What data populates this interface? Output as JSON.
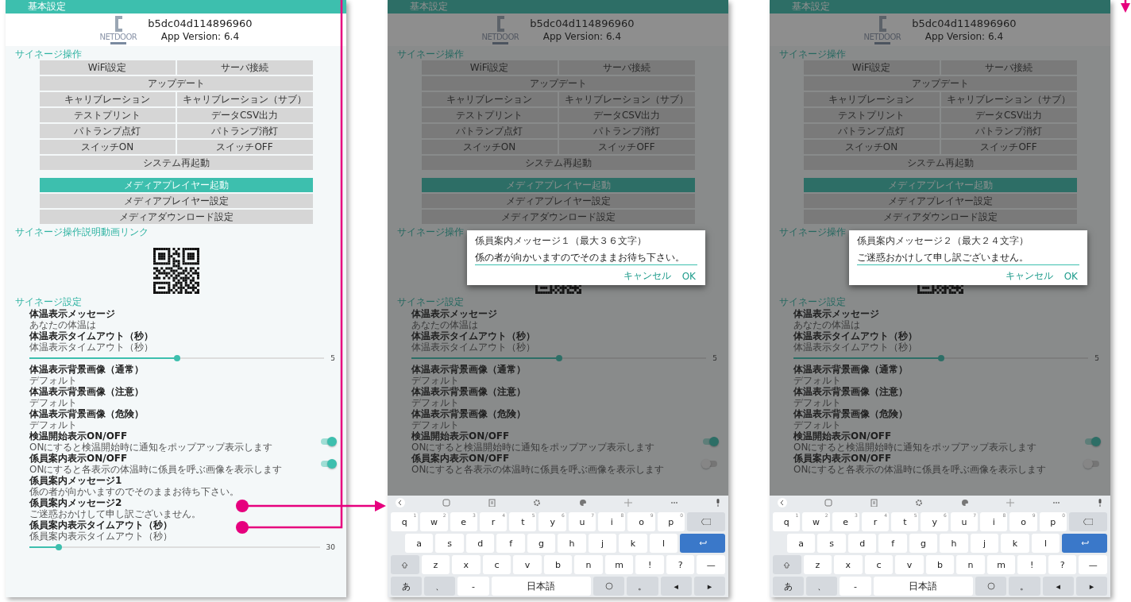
{
  "screens": [
    {
      "app_bar": {
        "title": "基本設定"
      },
      "device": {
        "id": "b5dc04d114896960",
        "version": "App Version: 6.4"
      },
      "logo_text": "NETDOOR",
      "sections": [
        {
          "kind": "buttons",
          "title": "サイネージ操作",
          "groups": [
            [
              [
                {
                  "label": "WiFi設定",
                  "highlighted": false
                },
                {
                  "label": "サーバ接続",
                  "highlighted": false
                }
              ]
            ],
            [
              [
                {
                  "label": "アップデート",
                  "highlighted": false
                }
              ]
            ],
            [
              [
                {
                  "label": "キャリブレーション",
                  "highlighted": false
                },
                {
                  "label": "キャリブレーション（サブ）",
                  "highlighted": false
                }
              ]
            ],
            [
              [
                {
                  "label": "テストプリント",
                  "highlighted": false
                },
                {
                  "label": "データCSV出力",
                  "highlighted": false
                }
              ]
            ],
            [
              [
                {
                  "label": "パトランプ点灯",
                  "highlighted": false
                },
                {
                  "label": "パトランプ消灯",
                  "highlighted": false
                }
              ]
            ],
            [
              [
                {
                  "label": "スイッチON",
                  "highlighted": false
                },
                {
                  "label": "スイッチOFF",
                  "highlighted": false
                }
              ]
            ],
            [
              [
                {
                  "label": "システム再起動",
                  "highlighted": false
                }
              ],
              [
                {
                  "label": "メディアプレイヤー起動",
                  "highlighted": true
                }
              ],
              [
                {
                  "label": "メディアプレイヤー設定",
                  "highlighted": false
                }
              ],
              [
                {
                  "label": "メディアダウンロード設定",
                  "highlighted": false
                }
              ]
            ]
          ]
        },
        {
          "kind": "qr",
          "title": "サイネージ操作説明動画リンク"
        },
        {
          "kind": "settings",
          "title": "サイネージ設定",
          "items": [
            {
              "kind": "text",
              "title": "体温表示メッセージ",
              "summary": "あなたの体温は"
            },
            {
              "kind": "slider",
              "title": "体温表示タイムアウト（秒）",
              "summary": "体温表示タイムアウト（秒）",
              "level": 0.5,
              "reading": "5"
            },
            {
              "kind": "text",
              "title": "体温表示背景画像（通常）",
              "summary": "デフォルト"
            },
            {
              "kind": "text",
              "title": "体温表示背景画像（注意）",
              "summary": "デフォルト"
            },
            {
              "kind": "text",
              "title": "体温表示背景画像（危険）",
              "summary": "デフォルト"
            },
            {
              "kind": "toggle",
              "title": "検温開始表示ON/OFF",
              "summary": "ONにすると検温開始時に通知をポップアップ表示します",
              "on": true
            },
            {
              "kind": "toggle",
              "title": "係員案内表示ON/OFF",
              "summary": "ONにすると各表示の体温時に係員を呼ぶ画像を表示します",
              "on": true
            },
            {
              "kind": "text",
              "title": "係員案内メッセージ1",
              "summary": "係の者が向かいますのでそのままお待ち下さい。"
            },
            {
              "kind": "text",
              "title": "係員案内メッセージ2",
              "summary": "ご迷惑おかけして申し訳ございません。"
            },
            {
              "kind": "slider",
              "title": "係員案内表示タイムアウト（秒）",
              "summary": "係員案内表示タイムアウト（秒）",
              "level": 0.1,
              "reading": "30"
            }
          ]
        }
      ]
    },
    {
      "app_bar": {
        "title": "基本設定"
      },
      "device": {
        "id": "b5dc04d114896960",
        "version": "App Version: 6.4"
      },
      "logo_text": "NETDOOR",
      "sections": [
        {
          "kind": "buttons",
          "title": "サイネージ操作",
          "groups": [
            [
              [
                {
                  "label": "WiFi設定",
                  "highlighted": false
                },
                {
                  "label": "サーバ接続",
                  "highlighted": false
                }
              ]
            ],
            [
              [
                {
                  "label": "アップデート",
                  "highlighted": false
                }
              ]
            ],
            [
              [
                {
                  "label": "キャリブレーション",
                  "highlighted": false
                },
                {
                  "label": "キャリブレーション（サブ）",
                  "highlighted": false
                }
              ]
            ],
            [
              [
                {
                  "label": "テストプリント",
                  "highlighted": false
                },
                {
                  "label": "データCSV出力",
                  "highlighted": false
                }
              ]
            ],
            [
              [
                {
                  "label": "パトランプ点灯",
                  "highlighted": false
                },
                {
                  "label": "パトランプ消灯",
                  "highlighted": false
                }
              ]
            ],
            [
              [
                {
                  "label": "スイッチON",
                  "highlighted": false
                },
                {
                  "label": "スイッチOFF",
                  "highlighted": false
                }
              ]
            ],
            [
              [
                {
                  "label": "システム再起動",
                  "highlighted": false
                }
              ],
              [
                {
                  "label": "メディアプレイヤー起動",
                  "highlighted": true
                }
              ],
              [
                {
                  "label": "メディアプレイヤー設定",
                  "highlighted": false
                }
              ],
              [
                {
                  "label": "メディアダウンロード設定",
                  "highlighted": false
                }
              ]
            ]
          ]
        },
        {
          "kind": "qr",
          "title": "サイネージ操作"
        },
        {
          "kind": "settings",
          "title": "サイネージ設定",
          "items": [
            {
              "kind": "text",
              "title": "体温表示メッセージ",
              "summary": "あなたの体温は"
            },
            {
              "kind": "slider",
              "title": "体温表示タイムアウト（秒）",
              "summary": "体温表示タイムアウト（秒）",
              "level": 0.5,
              "reading": "5"
            },
            {
              "kind": "text",
              "title": "体温表示背景画像（通常）",
              "summary": "デフォルト"
            },
            {
              "kind": "text",
              "title": "体温表示背景画像（注意）",
              "summary": "デフォルト"
            },
            {
              "kind": "text",
              "title": "体温表示背景画像（危険）",
              "summary": "デフォルト"
            },
            {
              "kind": "toggle",
              "title": "検温開始表示ON/OFF",
              "summary": "ONにすると検温開始時に通知をポップアップ表示します",
              "on": true
            },
            {
              "kind": "toggle",
              "title": "係員案内表示ON/OFF",
              "summary": "ONにすると各表示の体温時に係員を呼ぶ画像を表示します",
              "on": false
            }
          ]
        }
      ],
      "dialog": {
        "title": "係員案内メッセージ１（最大３６文字）",
        "value": "係の者が向かいますのでそのままお待ち下さい。",
        "buttons": [
          "キャンセル",
          "OK"
        ]
      },
      "keyboard": {
        "rows": [
          {
            "keys": [
              {
                "kind": "char",
                "label": "q",
                "hint": "1"
              },
              {
                "kind": "char",
                "label": "w",
                "hint": "2"
              },
              {
                "kind": "char",
                "label": "e",
                "hint": "3"
              },
              {
                "kind": "char",
                "label": "r",
                "hint": "4"
              },
              {
                "kind": "char",
                "label": "t",
                "hint": "5"
              },
              {
                "kind": "char",
                "label": "y",
                "hint": "6"
              },
              {
                "kind": "char",
                "label": "u",
                "hint": "7"
              },
              {
                "kind": "char",
                "label": "i",
                "hint": "8"
              },
              {
                "kind": "char",
                "label": "o",
                "hint": "9"
              },
              {
                "kind": "char",
                "label": "p",
                "hint": "0"
              },
              {
                "kind": "backspace"
              }
            ]
          },
          {
            "keys": [
              {
                "kind": "char",
                "label": "a"
              },
              {
                "kind": "char",
                "label": "s"
              },
              {
                "kind": "char",
                "label": "d"
              },
              {
                "kind": "char",
                "label": "f"
              },
              {
                "kind": "char",
                "label": "g"
              },
              {
                "kind": "char",
                "label": "h"
              },
              {
                "kind": "char",
                "label": "j"
              },
              {
                "kind": "char",
                "label": "k"
              },
              {
                "kind": "char",
                "label": "l"
              },
              {
                "kind": "enter"
              }
            ]
          },
          {
            "keys": [
              {
                "kind": "shift"
              },
              {
                "kind": "char",
                "label": "z"
              },
              {
                "kind": "char",
                "label": "x"
              },
              {
                "kind": "char",
                "label": "c"
              },
              {
                "kind": "char",
                "label": "v"
              },
              {
                "kind": "char",
                "label": "b"
              },
              {
                "kind": "char",
                "label": "n"
              },
              {
                "kind": "char",
                "label": "m"
              },
              {
                "kind": "char",
                "label": "!"
              },
              {
                "kind": "char",
                "label": "?"
              },
              {
                "kind": "char",
                "label": "—"
              }
            ]
          },
          {
            "keys": [
              {
                "kind": "func",
                "label": "あ"
              },
              {
                "kind": "func",
                "label": "、"
              },
              {
                "kind": "char",
                "label": "-"
              },
              {
                "kind": "space",
                "label": "日本語"
              },
              {
                "kind": "emoji"
              },
              {
                "kind": "func",
                "label": "。"
              },
              {
                "kind": "func",
                "label": "◂"
              },
              {
                "kind": "func",
                "label": "▸"
              }
            ]
          }
        ]
      }
    },
    {
      "app_bar": {
        "title": "基本設定"
      },
      "device": {
        "id": "b5dc04d114896960",
        "version": "App Version: 6.4"
      },
      "logo_text": "NETDOOR",
      "sections": [
        {
          "kind": "buttons",
          "title": "サイネージ操作",
          "groups": [
            [
              [
                {
                  "label": "WiFi設定",
                  "highlighted": false
                },
                {
                  "label": "サーバ接続",
                  "highlighted": false
                }
              ]
            ],
            [
              [
                {
                  "label": "アップデート",
                  "highlighted": false
                }
              ]
            ],
            [
              [
                {
                  "label": "キャリブレーション",
                  "highlighted": false
                },
                {
                  "label": "キャリブレーション（サブ）",
                  "highlighted": false
                }
              ]
            ],
            [
              [
                {
                  "label": "テストプリント",
                  "highlighted": false
                },
                {
                  "label": "データCSV出力",
                  "highlighted": false
                }
              ]
            ],
            [
              [
                {
                  "label": "パトランプ点灯",
                  "highlighted": false
                },
                {
                  "label": "パトランプ消灯",
                  "highlighted": false
                }
              ]
            ],
            [
              [
                {
                  "label": "スイッチON",
                  "highlighted": false
                },
                {
                  "label": "スイッチOFF",
                  "highlighted": false
                }
              ]
            ],
            [
              [
                {
                  "label": "システム再起動",
                  "highlighted": false
                }
              ],
              [
                {
                  "label": "メディアプレイヤー起動",
                  "highlighted": true
                }
              ],
              [
                {
                  "label": "メディアプレイヤー設定",
                  "highlighted": false
                }
              ],
              [
                {
                  "label": "メディアダウンロード設定",
                  "highlighted": false
                }
              ]
            ]
          ]
        },
        {
          "kind": "qr",
          "title": "サイネージ操作"
        },
        {
          "kind": "settings",
          "title": "サイネージ設定",
          "items": [
            {
              "kind": "text",
              "title": "体温表示メッセージ",
              "summary": "あなたの体温は"
            },
            {
              "kind": "slider",
              "title": "体温表示タイムアウト（秒）",
              "summary": "体温表示タイムアウト（秒）",
              "level": 0.5,
              "reading": "5"
            },
            {
              "kind": "text",
              "title": "体温表示背景画像（通常）",
              "summary": "デフォルト"
            },
            {
              "kind": "text",
              "title": "体温表示背景画像（注意）",
              "summary": "デフォルト"
            },
            {
              "kind": "text",
              "title": "体温表示背景画像（危険）",
              "summary": "デフォルト"
            },
            {
              "kind": "toggle",
              "title": "検温開始表示ON/OFF",
              "summary": "ONにすると検温開始時に通知をポップアップ表示します",
              "on": true
            },
            {
              "kind": "toggle",
              "title": "係員案内表示ON/OFF",
              "summary": "ONにすると各表示の体温時に係員を呼ぶ画像を表示します",
              "on": false
            }
          ]
        }
      ],
      "dialog": {
        "title": "係員案内メッセージ２（最大２４文字）",
        "value": "ご迷惑おかけして申し訳ございません。",
        "buttons": [
          "キャンセル",
          "OK"
        ]
      },
      "keyboard": {
        "rows": [
          {
            "keys": [
              {
                "kind": "char",
                "label": "q",
                "hint": "1"
              },
              {
                "kind": "char",
                "label": "w",
                "hint": "2"
              },
              {
                "kind": "char",
                "label": "e",
                "hint": "3"
              },
              {
                "kind": "char",
                "label": "r",
                "hint": "4"
              },
              {
                "kind": "char",
                "label": "t",
                "hint": "5"
              },
              {
                "kind": "char",
                "label": "y",
                "hint": "6"
              },
              {
                "kind": "char",
                "label": "u",
                "hint": "7"
              },
              {
                "kind": "char",
                "label": "i",
                "hint": "8"
              },
              {
                "kind": "char",
                "label": "o",
                "hint": "9"
              },
              {
                "kind": "char",
                "label": "p",
                "hint": "0"
              },
              {
                "kind": "backspace"
              }
            ]
          },
          {
            "keys": [
              {
                "kind": "char",
                "label": "a"
              },
              {
                "kind": "char",
                "label": "s"
              },
              {
                "kind": "char",
                "label": "d"
              },
              {
                "kind": "char",
                "label": "f"
              },
              {
                "kind": "char",
                "label": "g"
              },
              {
                "kind": "char",
                "label": "h"
              },
              {
                "kind": "char",
                "label": "j"
              },
              {
                "kind": "char",
                "label": "k"
              },
              {
                "kind": "char",
                "label": "l"
              },
              {
                "kind": "enter"
              }
            ]
          },
          {
            "keys": [
              {
                "kind": "shift"
              },
              {
                "kind": "char",
                "label": "z"
              },
              {
                "kind": "char",
                "label": "x"
              },
              {
                "kind": "char",
                "label": "c"
              },
              {
                "kind": "char",
                "label": "v"
              },
              {
                "kind": "char",
                "label": "b"
              },
              {
                "kind": "char",
                "label": "n"
              },
              {
                "kind": "char",
                "label": "m"
              },
              {
                "kind": "char",
                "label": "!"
              },
              {
                "kind": "char",
                "label": "?"
              },
              {
                "kind": "char",
                "label": "—"
              }
            ]
          },
          {
            "keys": [
              {
                "kind": "func",
                "label": "あ"
              },
              {
                "kind": "func",
                "label": "、"
              },
              {
                "kind": "char",
                "label": "-"
              },
              {
                "kind": "space",
                "label": "日本語"
              },
              {
                "kind": "emoji"
              },
              {
                "kind": "func",
                "label": "。"
              },
              {
                "kind": "func",
                "label": "◂"
              },
              {
                "kind": "func",
                "label": "▸"
              }
            ]
          }
        ]
      }
    }
  ]
}
